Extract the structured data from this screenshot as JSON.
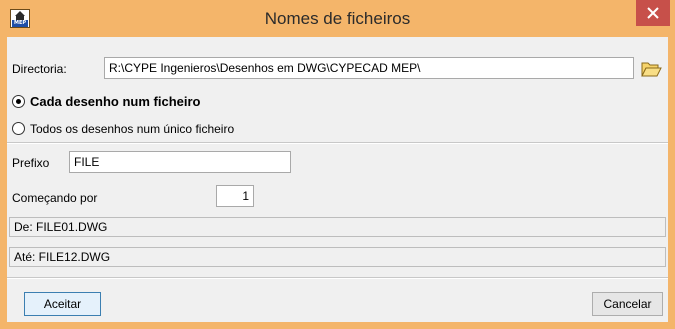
{
  "window": {
    "title": "Nomes de ficheiros",
    "icon": "cype-mep-icon"
  },
  "directory": {
    "label": "Directoria:",
    "value": "R:\\CYPE Ingenieros\\Desenhos em DWG\\CYPECAD MEP\\"
  },
  "options": [
    {
      "label": "Cada desenho num ficheiro",
      "checked": true
    },
    {
      "label": "Todos os desenhos num único ficheiro",
      "checked": false
    }
  ],
  "prefix": {
    "label": "Prefixo",
    "value": "FILE"
  },
  "start": {
    "label": "Começando por",
    "value": "1"
  },
  "range": {
    "from": "De: FILE01.DWG",
    "to": "Até: FILE12.DWG"
  },
  "buttons": {
    "accept": "Aceitar",
    "cancel": "Cancelar"
  },
  "colors": {
    "titlebar": "#f4b56a",
    "close": "#c7504a",
    "dialog_bg": "#f0f0f0"
  }
}
